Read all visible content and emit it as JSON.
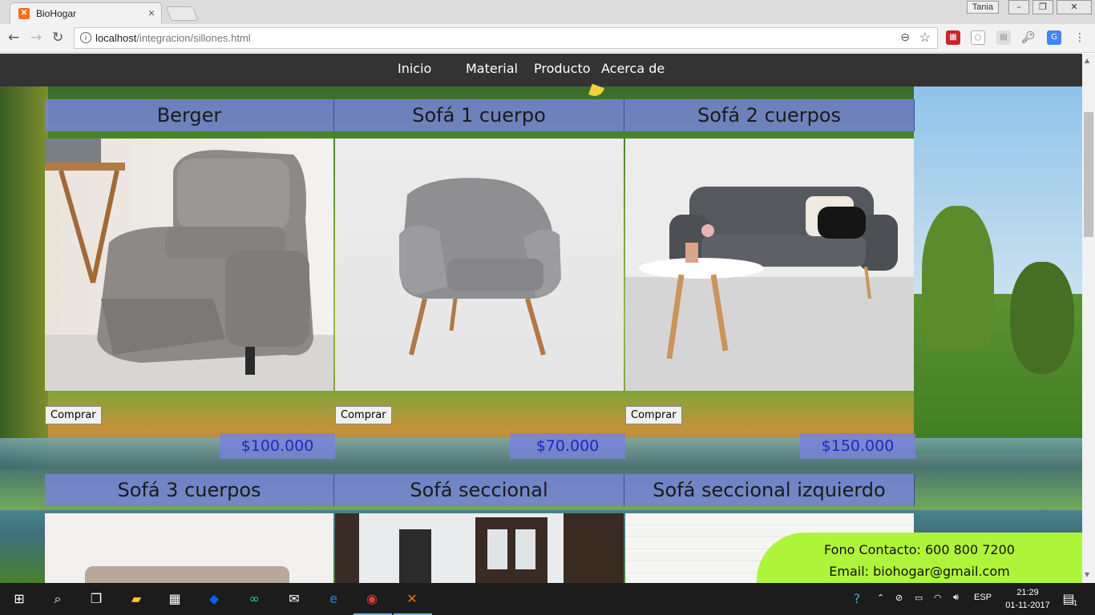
{
  "browser": {
    "tab_title": "BioHogar",
    "tab_favicon": "xampp-icon",
    "user_label": "Tania",
    "url_host": "localhost",
    "url_path": "/integracion/sillones.html"
  },
  "nav": {
    "items": [
      "Inicio",
      "Material",
      "Producto",
      "Acerca de"
    ]
  },
  "products": [
    {
      "name": "Berger",
      "buy_label": "Comprar",
      "price": "$100.000"
    },
    {
      "name": "Sofá 1 cuerpo",
      "buy_label": "Comprar",
      "price": "$70.000"
    },
    {
      "name": "Sofá 2 cuerpos",
      "buy_label": "Comprar",
      "price": "$150.000"
    },
    {
      "name": "Sofá 3 cuerpos"
    },
    {
      "name": "Sofá seccional"
    },
    {
      "name": "Sofá seccional izquierdo"
    }
  ],
  "contact": {
    "phone": "Fono Contacto: 600 800 7200",
    "email": "Email: biohogar@gmail.com"
  },
  "taskbar": {
    "language": "ESP",
    "time": "21:29",
    "date": "01-11-2017",
    "notification_count": "1"
  },
  "colors": {
    "title_bg": "#7882dc",
    "price_text": "#1e2ac0",
    "contact_bg": "#aef43a",
    "navbar_bg": "#333333"
  }
}
